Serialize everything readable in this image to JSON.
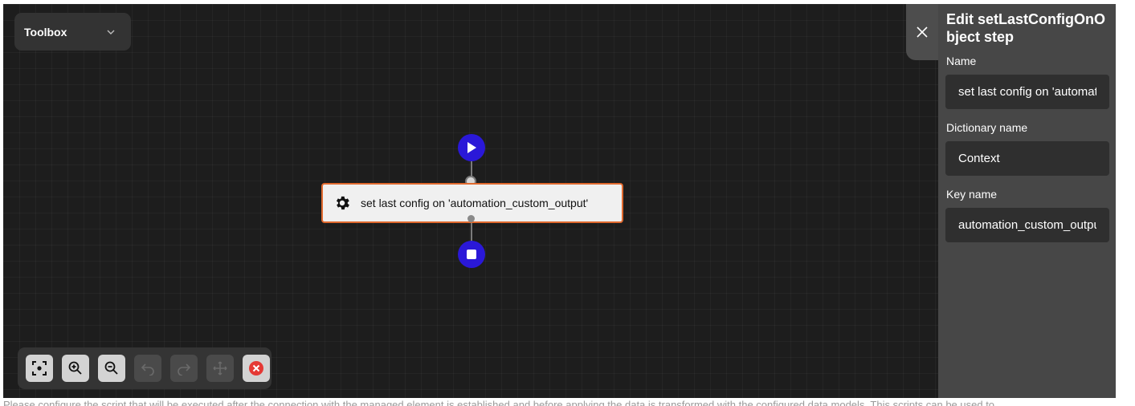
{
  "toolbox": {
    "label": "Toolbox",
    "chevron_icon": "chevron-down-icon"
  },
  "flow": {
    "start_icon": "play-icon",
    "end_icon": "stop-icon",
    "step": {
      "icon": "gear-icon",
      "label": "set last config on 'automation_custom_output'"
    },
    "accent_color": "#2a18d8",
    "step_border_color": "#e0692e"
  },
  "controls": [
    {
      "name": "fit-view-button",
      "icon": "focus-frame-icon",
      "enabled": true
    },
    {
      "name": "zoom-in-button",
      "icon": "zoom-in-icon",
      "enabled": true
    },
    {
      "name": "zoom-out-button",
      "icon": "zoom-out-icon",
      "enabled": true
    },
    {
      "name": "undo-button",
      "icon": "undo-icon",
      "enabled": false
    },
    {
      "name": "redo-button",
      "icon": "redo-icon",
      "enabled": false
    },
    {
      "name": "move-button",
      "icon": "move-icon",
      "enabled": false
    },
    {
      "name": "delete-button",
      "icon": "close-circle-icon",
      "enabled": true
    }
  ],
  "panel": {
    "close_icon": "close-icon",
    "title": "Edit setLastConfigOnObject step",
    "fields": {
      "name": {
        "label": "Name",
        "value": "set last config on 'automation_custom_output'"
      },
      "dictionary": {
        "label": "Dictionary name",
        "value": "Context"
      },
      "key": {
        "label": "Key name",
        "value": "automation_custom_output"
      }
    }
  },
  "footer": {
    "text": "Please configure the script that will be executed after the connection with the managed element is established and before applying the data is transformed with the configured data models. This scripts can be used to"
  }
}
